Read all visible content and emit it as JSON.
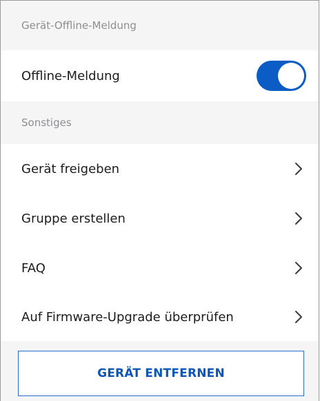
{
  "sections": {
    "offline": {
      "header": "Gerät-Offline-Meldung",
      "toggle_row": {
        "label": "Offline-Meldung",
        "enabled": true
      }
    },
    "misc": {
      "header": "Sonstiges",
      "items": [
        {
          "label": "Gerät freigeben",
          "icon": "chevron-right-icon"
        },
        {
          "label": "Gruppe erstellen",
          "icon": "chevron-right-icon"
        },
        {
          "label": "FAQ",
          "icon": "chevron-right-icon"
        },
        {
          "label": "Auf Firmware-Upgrade überprüfen",
          "icon": "chevron-right-icon"
        }
      ]
    }
  },
  "remove_button": {
    "label": "GERÄT ENTFERNEN"
  },
  "colors": {
    "accent": "#0b5cc4",
    "background": "#f5f5f5",
    "header_text": "#8e8e93"
  }
}
